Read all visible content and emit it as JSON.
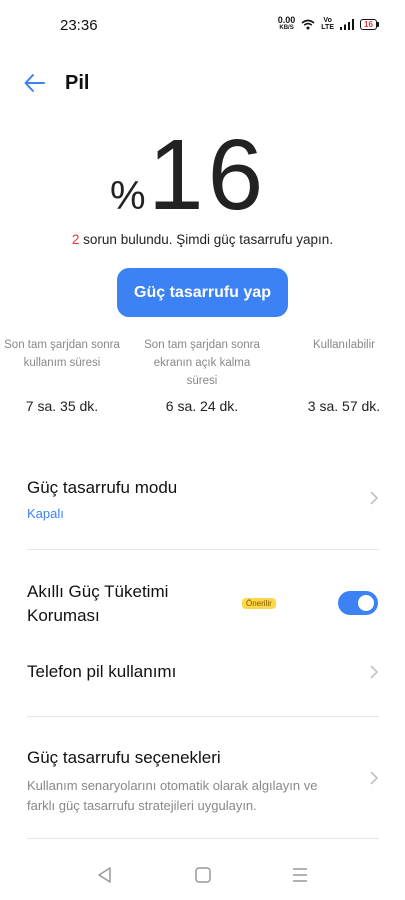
{
  "status_bar": {
    "time": "23:36",
    "net_speed_value": "0.00",
    "net_speed_unit": "KB/S",
    "volte_top": "Vo",
    "volte_bottom": "LTE",
    "battery_level": "16"
  },
  "header": {
    "title": "Pil"
  },
  "battery": {
    "percent_sign": "%",
    "percent_value": "16"
  },
  "issues": {
    "count": "2",
    "text": " sorun bulundu. Şimdi güç tasarrufu yapın."
  },
  "save_button": {
    "label": "Güç tasarrufu yap"
  },
  "stats": [
    {
      "label": "Son tam şarjdan sonra kullanım süresi",
      "value": "7 sa. 35 dk."
    },
    {
      "label": "Son tam şarjdan sonra ekranın açık kalma süresi",
      "value": "6 sa. 24 dk."
    },
    {
      "label": "Kullanılabilir",
      "value": "3 sa. 57 dk."
    }
  ],
  "settings": {
    "power_mode": {
      "title": "Güç tasarrufu modu",
      "status": "Kapalı"
    },
    "smart_protection": {
      "title": "Akıllı Güç Tüketimi Koruması",
      "badge": "Önerilir",
      "enabled": true
    },
    "phone_usage": {
      "title": "Telefon pil kullanımı"
    },
    "options": {
      "title": "Güç tasarrufu seçenekleri",
      "desc": "Kullanım senaryolarını otomatik olarak algılayın ve farklı güç tasarrufu stratejileri uygulayın."
    }
  },
  "colors": {
    "accent": "#3d82f5",
    "warning": "#e53935",
    "badge": "#ffd54a"
  },
  "icons": {
    "back": "back-arrow-icon",
    "chevron": "chevron-right-icon",
    "nav_back": "triangle-back-icon",
    "nav_home": "square-home-icon",
    "nav_menu": "menu-lines-icon"
  }
}
